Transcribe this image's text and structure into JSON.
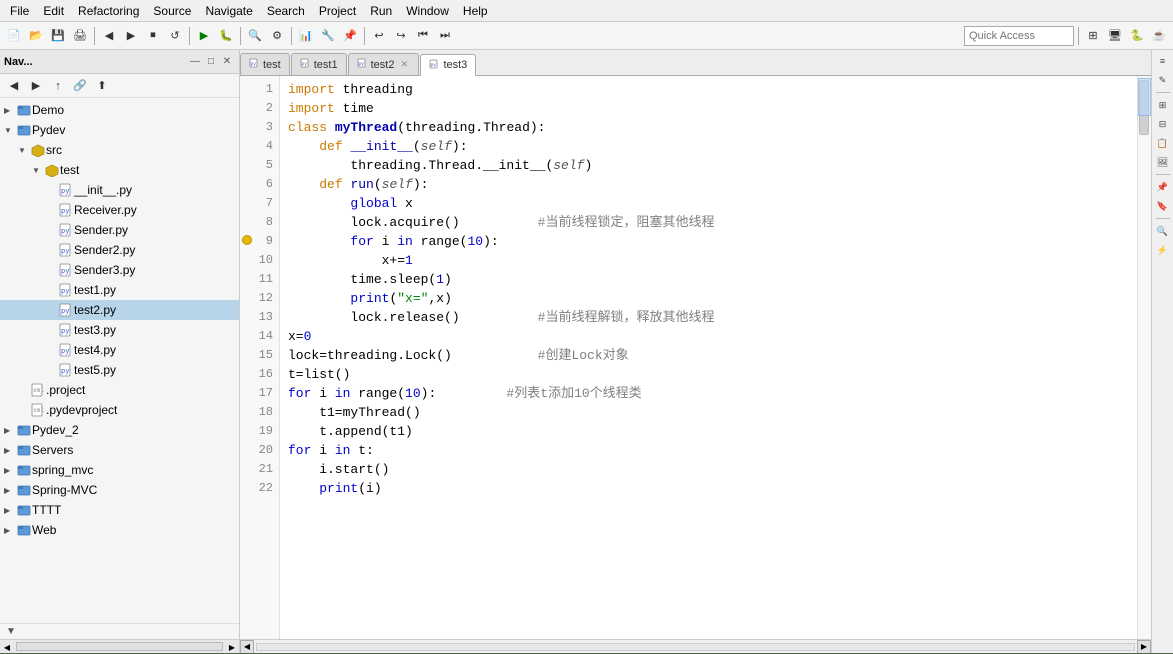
{
  "menubar": {
    "items": [
      "File",
      "Edit",
      "Refactoring",
      "Source",
      "Navigate",
      "Search",
      "Project",
      "Run",
      "Window",
      "Help"
    ]
  },
  "toolbar": {
    "quick_access_placeholder": "Quick Access"
  },
  "left_panel": {
    "title": "Nav...",
    "tree": [
      {
        "id": "demo",
        "label": "Demo",
        "level": 0,
        "type": "project",
        "icon": "🗂"
      },
      {
        "id": "pydev",
        "label": "Pydev",
        "level": 0,
        "type": "project",
        "icon": "🗂"
      },
      {
        "id": "src",
        "label": "src",
        "level": 1,
        "type": "package",
        "icon": "📦"
      },
      {
        "id": "test",
        "label": "test",
        "level": 2,
        "type": "package",
        "icon": "📦"
      },
      {
        "id": "init",
        "label": "__init__.py",
        "level": 3,
        "type": "py",
        "icon": "🐍"
      },
      {
        "id": "receiver",
        "label": "Receiver.py",
        "level": 3,
        "type": "py",
        "icon": "🐍"
      },
      {
        "id": "sender",
        "label": "Sender.py",
        "level": 3,
        "type": "py",
        "icon": "🐍"
      },
      {
        "id": "sender2",
        "label": "Sender2.py",
        "level": 3,
        "type": "py",
        "icon": "🐍"
      },
      {
        "id": "sender3",
        "label": "Sender3.py",
        "level": 3,
        "type": "py",
        "icon": "🐍"
      },
      {
        "id": "test1",
        "label": "test1.py",
        "level": 3,
        "type": "py",
        "icon": "🐍"
      },
      {
        "id": "test2",
        "label": "test2.py",
        "level": 3,
        "type": "py",
        "icon": "🐍",
        "selected": true
      },
      {
        "id": "test3",
        "label": "test3.py",
        "level": 3,
        "type": "py",
        "icon": "🐍"
      },
      {
        "id": "test4",
        "label": "test4.py",
        "level": 3,
        "type": "py",
        "icon": "🐍"
      },
      {
        "id": "test5",
        "label": "test5.py",
        "level": 3,
        "type": "py",
        "icon": "🐍"
      },
      {
        "id": "dotproject",
        "label": ".project",
        "level": 1,
        "type": "xml",
        "icon": "📄"
      },
      {
        "id": "pydevproject",
        "label": ".pydevproject",
        "level": 1,
        "type": "xml",
        "icon": "📄"
      },
      {
        "id": "pydev2",
        "label": "Pydev_2",
        "level": 0,
        "type": "project",
        "icon": "🗂"
      },
      {
        "id": "servers",
        "label": "Servers",
        "level": 0,
        "type": "project",
        "icon": "🗂"
      },
      {
        "id": "spring_mvc",
        "label": "spring_mvc",
        "level": 0,
        "type": "project",
        "icon": "🗂"
      },
      {
        "id": "spring_mvc2",
        "label": "Spring-MVC",
        "level": 0,
        "type": "project",
        "icon": "🗂"
      },
      {
        "id": "tttt",
        "label": "TTTT",
        "level": 0,
        "type": "project",
        "icon": "🗂"
      },
      {
        "id": "web",
        "label": "Web",
        "level": 0,
        "type": "project",
        "icon": "🗂"
      }
    ]
  },
  "tabs": [
    {
      "id": "test",
      "label": "test",
      "active": false,
      "closeable": false
    },
    {
      "id": "test1",
      "label": "test1",
      "active": false,
      "closeable": false
    },
    {
      "id": "test2",
      "label": "test2",
      "active": false,
      "closeable": true
    },
    {
      "id": "test3",
      "label": "test3",
      "active": true,
      "closeable": false
    }
  ],
  "code": {
    "lines": [
      {
        "num": 1,
        "html": "<span class='kw'>import</span> threading"
      },
      {
        "num": 2,
        "html": "<span class='kw'>import</span> time"
      },
      {
        "num": 3,
        "html": "<span class='kw'>class</span> <span class='cls'>myThread</span>(threading.Thread):"
      },
      {
        "num": 4,
        "html": "    <span class='kw'>def</span> <span class='method'>__init__</span>(<span class='self'>self</span>):"
      },
      {
        "num": 5,
        "html": "        threading.Thread.__init__(<span class='self'>self</span>)"
      },
      {
        "num": 6,
        "html": "    <span class='kw'>def</span> <span class='method'>run</span>(<span class='self'>self</span>):"
      },
      {
        "num": 7,
        "html": "        <span class='kw-blue'>global</span> x"
      },
      {
        "num": 8,
        "html": "        lock.acquire()          <span class='cmt'>#当前线程锁定，阻塞其他线程</span>"
      },
      {
        "num": 9,
        "html": "        <span class='kw-blue'>for</span> i <span class='kw-blue'>in</span> range(<span class='num'>10</span>):",
        "breakpoint": true
      },
      {
        "num": 10,
        "html": "            x+=<span class='num'>1</span>"
      },
      {
        "num": 11,
        "html": "        time.sleep(<span class='num'>1</span>)"
      },
      {
        "num": 12,
        "html": "        <span class='kw-blue'>print</span>(<span class='str'>\"x=\"</span>,x)"
      },
      {
        "num": 13,
        "html": "        lock.release()          <span class='cmt'>#当前线程解锁，释放其他线程</span>"
      },
      {
        "num": 14,
        "html": "x=<span class='num'>0</span>"
      },
      {
        "num": 15,
        "html": "lock=threading.Lock()           <span class='cmt'>#创建Lock对象</span>"
      },
      {
        "num": 16,
        "html": "t=list()"
      },
      {
        "num": 17,
        "html": "<span class='kw-blue'>for</span> i <span class='kw-blue'>in</span> range(<span class='num'>10</span>):         <span class='cmt'>#列表t添加10个线程类</span>"
      },
      {
        "num": 18,
        "html": "    t1=myThread()"
      },
      {
        "num": 19,
        "html": "    t.append(t1)"
      },
      {
        "num": 20,
        "html": "<span class='kw-blue'>for</span> i <span class='kw-blue'>in</span> t:"
      },
      {
        "num": 21,
        "html": "    i.start()"
      },
      {
        "num": 22,
        "html": "    <span class='kw-blue'>print</span>(i)"
      }
    ]
  }
}
